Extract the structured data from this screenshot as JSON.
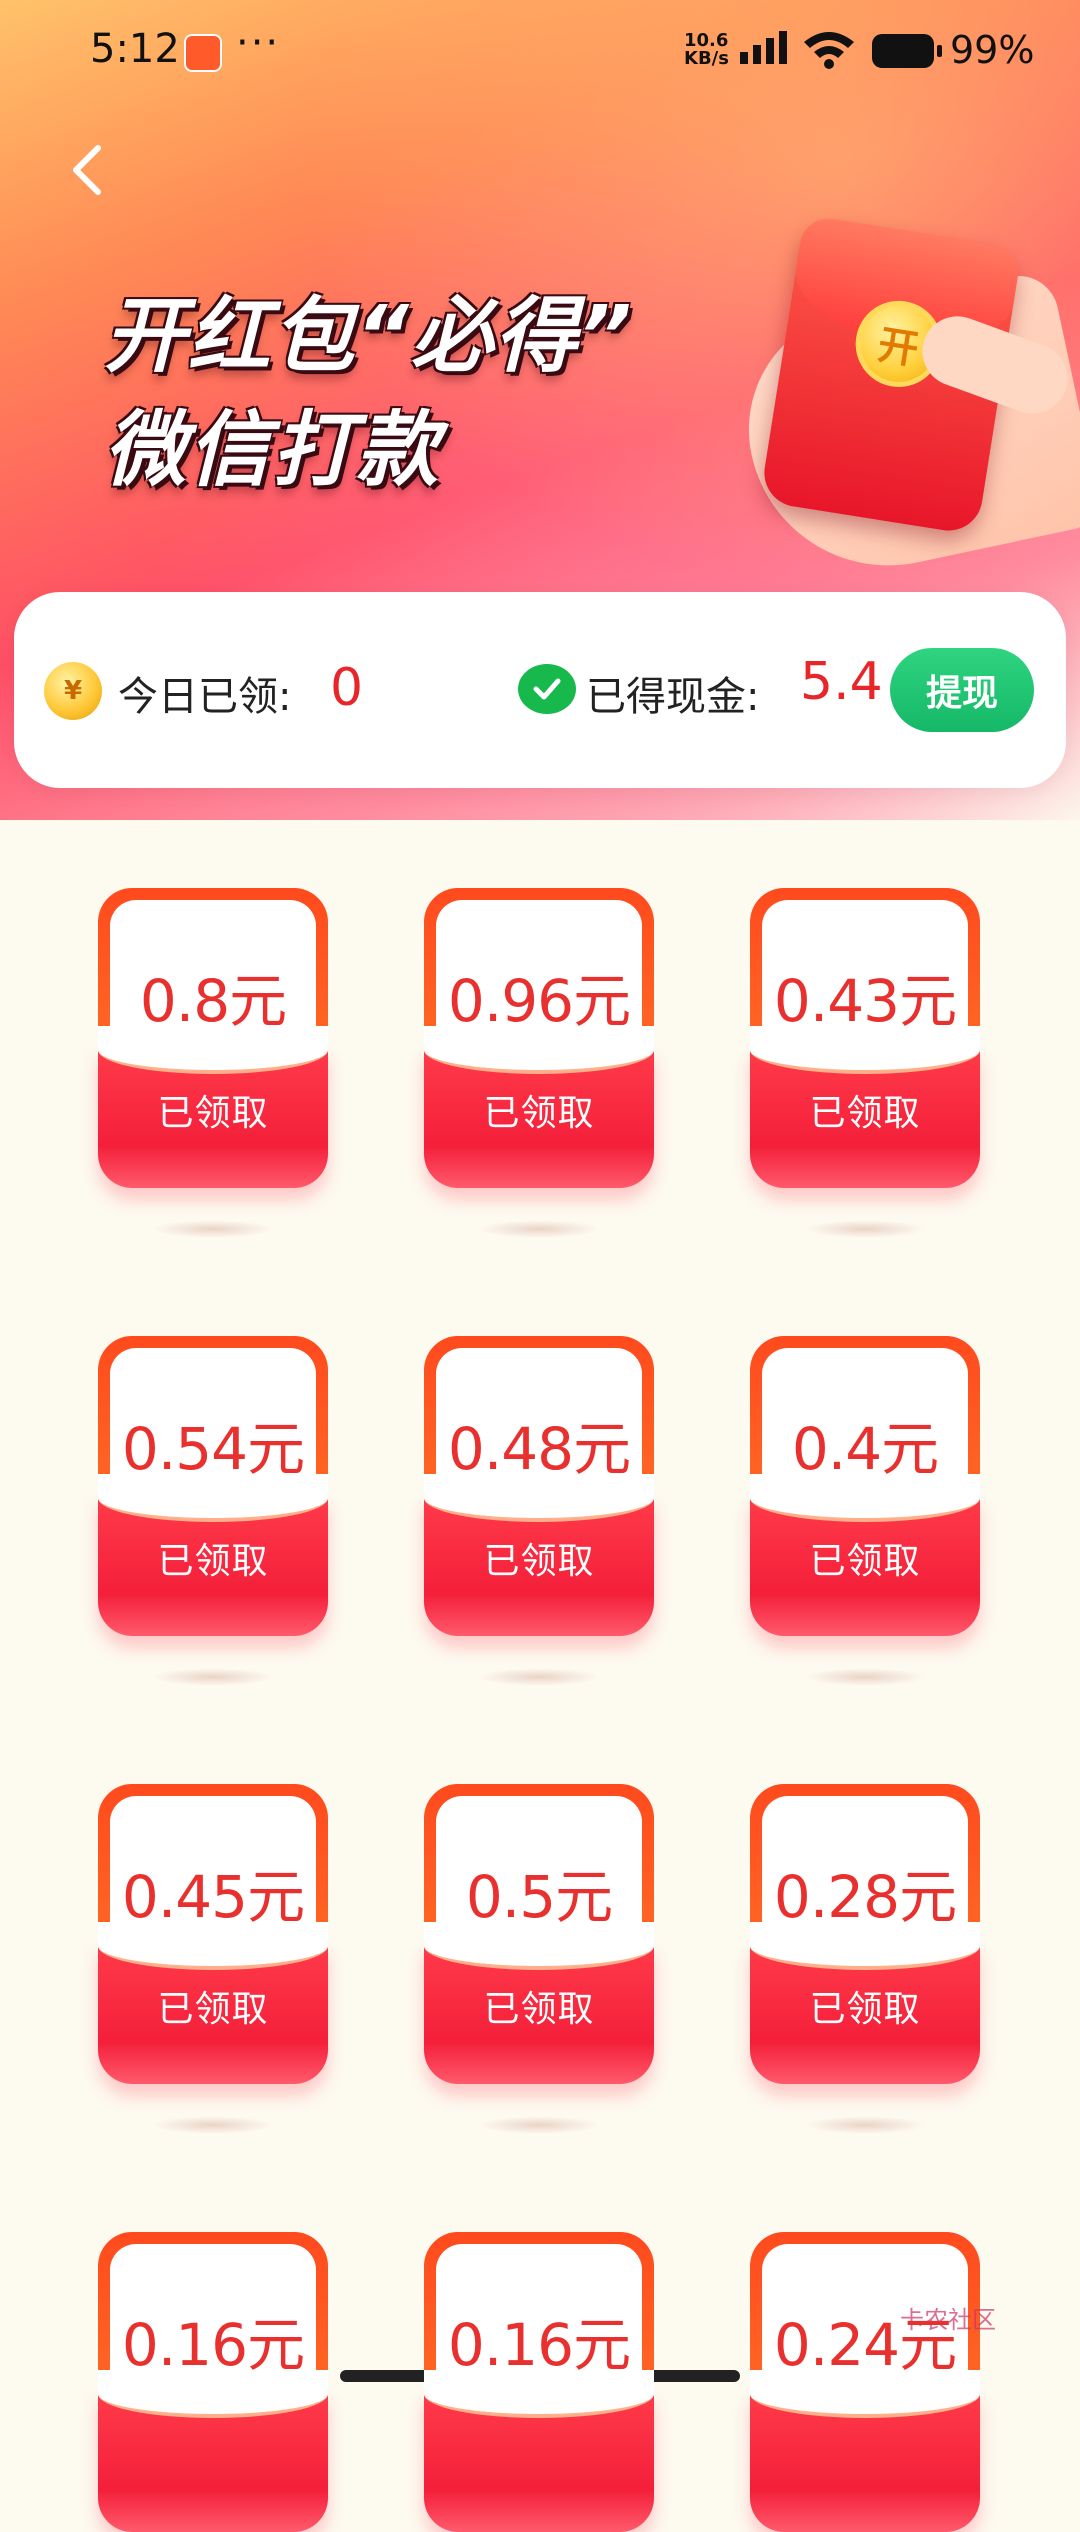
{
  "status": {
    "time": "5:12",
    "more": "···",
    "network_speed_top": "10.6",
    "network_speed_bottom": "KB/s",
    "battery": "99%"
  },
  "hero": {
    "title_line1": "开红包“必得”",
    "title_line2": "微信打款",
    "coin_glyph": "开"
  },
  "stats": {
    "coin_glyph": "¥",
    "today_label": "今日已领:",
    "today_value": "0",
    "cash_label": "已得现金:",
    "cash_value": "5.4",
    "withdraw_button": "提现"
  },
  "envelopes": [
    {
      "amount": "0.8元",
      "status": "已领取"
    },
    {
      "amount": "0.96元",
      "status": "已领取"
    },
    {
      "amount": "0.43元",
      "status": "已领取"
    },
    {
      "amount": "0.54元",
      "status": "已领取"
    },
    {
      "amount": "0.48元",
      "status": "已领取"
    },
    {
      "amount": "0.4元",
      "status": "已领取"
    },
    {
      "amount": "0.45元",
      "status": "已领取"
    },
    {
      "amount": "0.5元",
      "status": "已领取"
    },
    {
      "amount": "0.28元",
      "status": "已领取"
    },
    {
      "amount": "0.16元",
      "status": ""
    },
    {
      "amount": "0.16元",
      "status": ""
    },
    {
      "amount": "0.24元",
      "status": ""
    }
  ],
  "watermark": "卡农社区",
  "colors": {
    "accent_red": "#e8262a",
    "wechat_green": "#18b94c"
  }
}
